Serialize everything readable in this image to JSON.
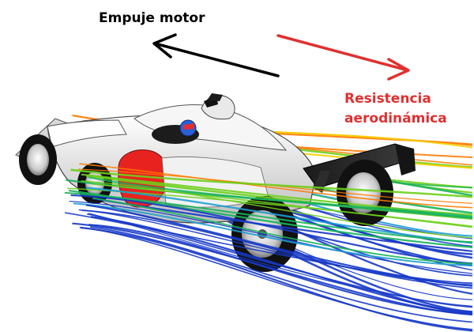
{
  "labels": {
    "thrust": "Empuje motor",
    "drag_line1": "Resistencia",
    "drag_line2": "aerodinámica"
  },
  "colors": {
    "thrust_arrow": "#000000",
    "drag_arrow": "#e03030",
    "car_body": "#f2f2f2",
    "sidepod_intake": "#e8231f",
    "helmet": "#2a5fd6",
    "tyre": "#111111",
    "rim": "#cfcfcf",
    "streamline_palette": [
      "#d01010",
      "#ff7a00",
      "#f4d000",
      "#6ccf1a",
      "#18b45a",
      "#1e9fd0",
      "#1638c8"
    ]
  },
  "icons": {
    "thrust_arrow": "arrow-left-up-icon",
    "drag_arrow": "arrow-right-down-icon"
  }
}
